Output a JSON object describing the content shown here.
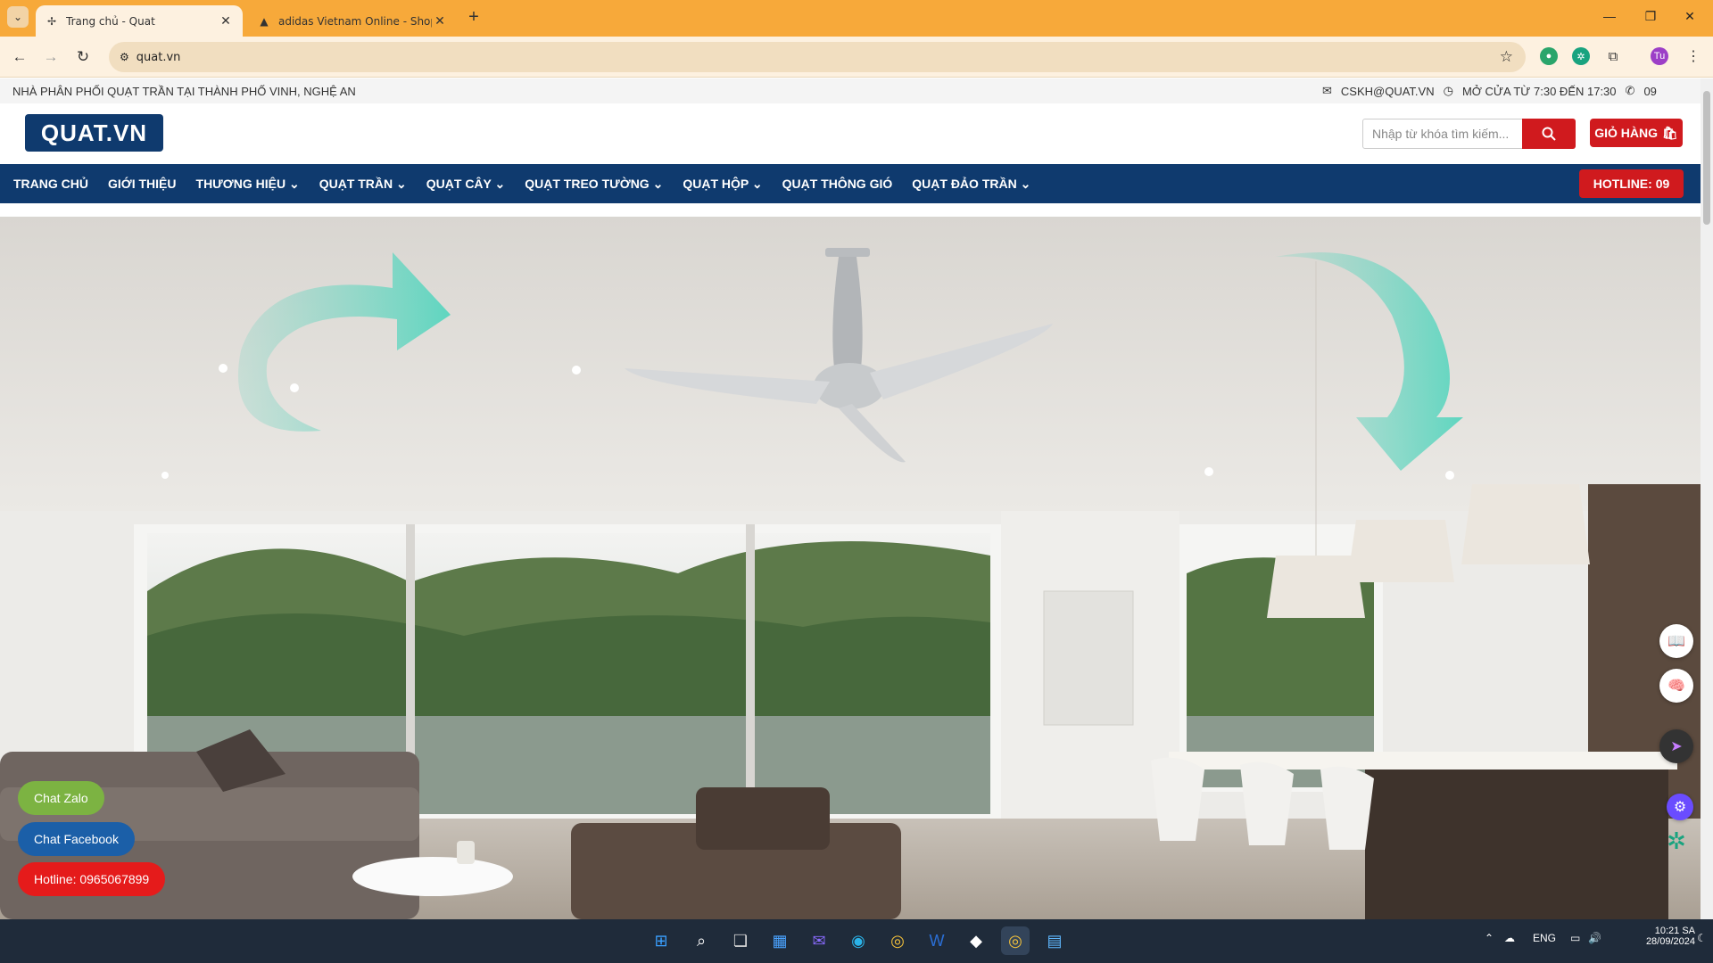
{
  "browser": {
    "tabs": [
      {
        "title": "Trang chủ - Quat",
        "active": true
      },
      {
        "title": "adidas Vietnam Online - Shop S",
        "active": false
      }
    ],
    "url": "quat.vn",
    "profile_initials": "Tu"
  },
  "topbar": {
    "tagline": "NHÀ PHÂN PHỐI QUẠT TRẦN TẠI THÀNH PHỐ VINH, NGHỆ AN",
    "email": "CSKH@QUAT.VN",
    "hours": "MỞ CỬA TỪ 7:30 ĐẾN 17:30",
    "phone": "09"
  },
  "header": {
    "logo": "QUAT.VN",
    "search_placeholder": "Nhập từ khóa tìm kiếm...",
    "cart_label": "GIỎ HÀNG"
  },
  "nav": {
    "items": [
      {
        "label": "TRANG CHỦ",
        "dropdown": false
      },
      {
        "label": "GIỚI THIỆU",
        "dropdown": false
      },
      {
        "label": "THƯƠNG HIỆU",
        "dropdown": true
      },
      {
        "label": "QUẠT TRẦN",
        "dropdown": true
      },
      {
        "label": "QUẠT CÂY",
        "dropdown": true
      },
      {
        "label": "QUẠT TREO TƯỜNG",
        "dropdown": true
      },
      {
        "label": "QUẠT HỘP",
        "dropdown": true
      },
      {
        "label": "QUẠT THÔNG GIÓ",
        "dropdown": false
      },
      {
        "label": "QUẠT ĐẢO TRẦN",
        "dropdown": true
      }
    ],
    "hotline": "HOTLINE: 09"
  },
  "floating": {
    "zalo": "Chat Zalo",
    "facebook": "Chat Facebook",
    "hotline": "Hotline: 0965067899"
  },
  "taskbar": {
    "lang": "ENG",
    "time": "10:21 SA",
    "date": "28/09/2024"
  },
  "colors": {
    "chrome_tab_bar": "#f7a93a",
    "navy": "#0f3a6e",
    "red": "#d01a1e",
    "zalo_green": "#7cb342",
    "facebook_blue": "#1b5fa8",
    "hotline_red": "#e51b1b"
  }
}
